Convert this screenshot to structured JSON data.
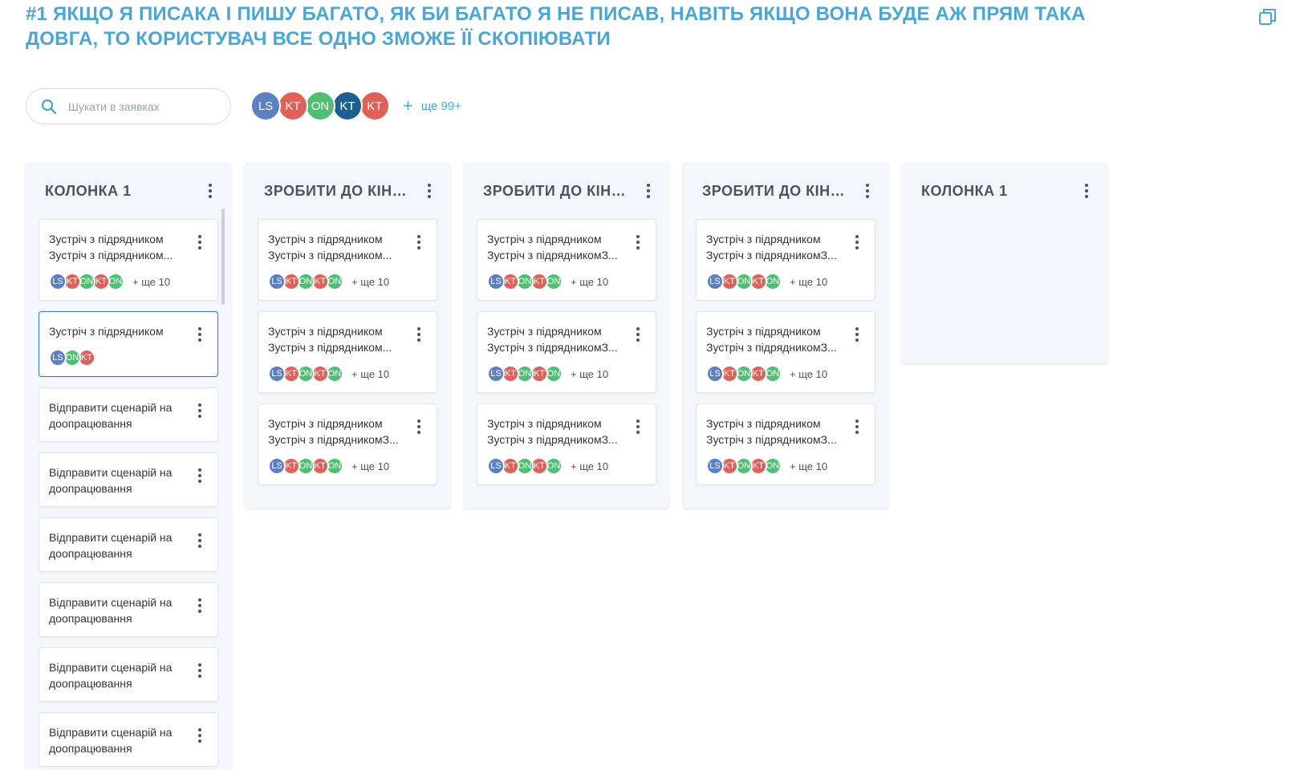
{
  "page": {
    "title": "#1 ЯКЩО Я ПИСАКА І ПИШУ БАГАТО, ЯК БИ БАГАТО Я НЕ ПИСАВ, НАВІТЬ ЯКЩО ВОНА БУДЕ АЖ ПРЯМ ТАКА ДОВГА, ТО КОРИСТУВАЧ ВСЕ ОДНО ЗМОЖЕ ЇЇ СКОПІЮВАТИ",
    "copy_icon": "copy-icon"
  },
  "search": {
    "placeholder": "Шукати в заявках",
    "value": "",
    "icon": "search-icon"
  },
  "members": {
    "avatars": [
      {
        "initials": "LS",
        "color": "#5b80c4"
      },
      {
        "initials": "KT",
        "color": "#e0615a"
      },
      {
        "initials": "ON",
        "color": "#4fbf72"
      },
      {
        "initials": "KT",
        "color": "#1e5f8f"
      },
      {
        "initials": "KT",
        "color": "#e0615a"
      }
    ],
    "more_label": "ще 99+"
  },
  "colors": {
    "accent": "#4aa6d4",
    "LS": "#5b80c4",
    "KT": "#e0615a",
    "ON": "#4fbf72",
    "selected_border": "#3d72c9"
  },
  "columns": [
    {
      "title": "КОЛОНКА 1",
      "cards": [
        {
          "lines": [
            "Зустріч з підрядником",
            "Зустріч з підрядником..."
          ],
          "avatars": [
            "LS",
            "KT",
            "ON",
            "KT",
            "ON"
          ],
          "more": "+ ще 10"
        },
        {
          "lines": [
            "Зустріч з підрядником"
          ],
          "avatars": [
            "LS",
            "ON",
            "KT"
          ],
          "more": "",
          "selected": true
        },
        {
          "lines": [
            "Відправити сценарій на",
            "доопрацювання"
          ],
          "avatars": [],
          "more": ""
        },
        {
          "lines": [
            "Відправити сценарій на",
            "доопрацювання"
          ],
          "avatars": [],
          "more": ""
        },
        {
          "lines": [
            "Відправити сценарій на",
            "доопрацювання"
          ],
          "avatars": [],
          "more": ""
        },
        {
          "lines": [
            "Відправити сценарій на",
            "доопрацювання"
          ],
          "avatars": [],
          "more": ""
        },
        {
          "lines": [
            "Відправити сценарій на",
            "доопрацювання"
          ],
          "avatars": [],
          "more": ""
        },
        {
          "lines": [
            "Відправити сценарій на",
            "доопрацювання"
          ],
          "avatars": [],
          "more": ""
        }
      ]
    },
    {
      "title": "ЗРОБИТИ ДО КІНЦЯ ТИЖНЯ",
      "cards": [
        {
          "lines": [
            "Зустріч з підрядником",
            "Зустріч з підрядником..."
          ],
          "avatars": [
            "LS",
            "KT",
            "ON",
            "KT",
            "ON"
          ],
          "more": "+ ще 10"
        },
        {
          "lines": [
            "Зустріч з підрядником",
            "Зустріч з підрядником..."
          ],
          "avatars": [
            "LS",
            "KT",
            "ON",
            "KT",
            "ON"
          ],
          "more": "+ ще 10"
        },
        {
          "lines": [
            "Зустріч з підрядником",
            "Зустріч з підрядникомЗ..."
          ],
          "avatars": [
            "LS",
            "KT",
            "ON",
            "KT",
            "ON"
          ],
          "more": "+ ще 10"
        }
      ]
    },
    {
      "title": "ЗРОБИТИ ДО КІНЦЯ ТИЖНЯ",
      "cards": [
        {
          "lines": [
            "Зустріч з підрядником",
            "Зустріч з підрядникомЗ..."
          ],
          "avatars": [
            "LS",
            "KT",
            "ON",
            "KT",
            "ON"
          ],
          "more": "+ ще 10"
        },
        {
          "lines": [
            "Зустріч з підрядником",
            "Зустріч з підрядникомЗ..."
          ],
          "avatars": [
            "LS",
            "KT",
            "ON",
            "KT",
            "ON"
          ],
          "more": "+ ще 10"
        },
        {
          "lines": [
            "Зустріч з підрядником",
            "Зустріч з підрядникомЗ..."
          ],
          "avatars": [
            "LS",
            "KT",
            "ON",
            "KT",
            "ON"
          ],
          "more": "+ ще 10"
        }
      ]
    },
    {
      "title": "ЗРОБИТИ ДО КІНЦЯ ТИЖНЯ",
      "cards": [
        {
          "lines": [
            "Зустріч з підрядником",
            "Зустріч з підрядникомЗ..."
          ],
          "avatars": [
            "LS",
            "KT",
            "ON",
            "KT",
            "ON"
          ],
          "more": "+ ще 10"
        },
        {
          "lines": [
            "Зустріч з підрядником",
            "Зустріч з підрядникомЗ..."
          ],
          "avatars": [
            "LS",
            "KT",
            "ON",
            "KT",
            "ON"
          ],
          "more": "+ ще 10"
        },
        {
          "lines": [
            "Зустріч з підрядником",
            "Зустріч з підрядникомЗ..."
          ],
          "avatars": [
            "LS",
            "KT",
            "ON",
            "KT",
            "ON"
          ],
          "more": "+ ще 10"
        }
      ]
    },
    {
      "title": "КОЛОНКА 1",
      "cards": []
    }
  ]
}
